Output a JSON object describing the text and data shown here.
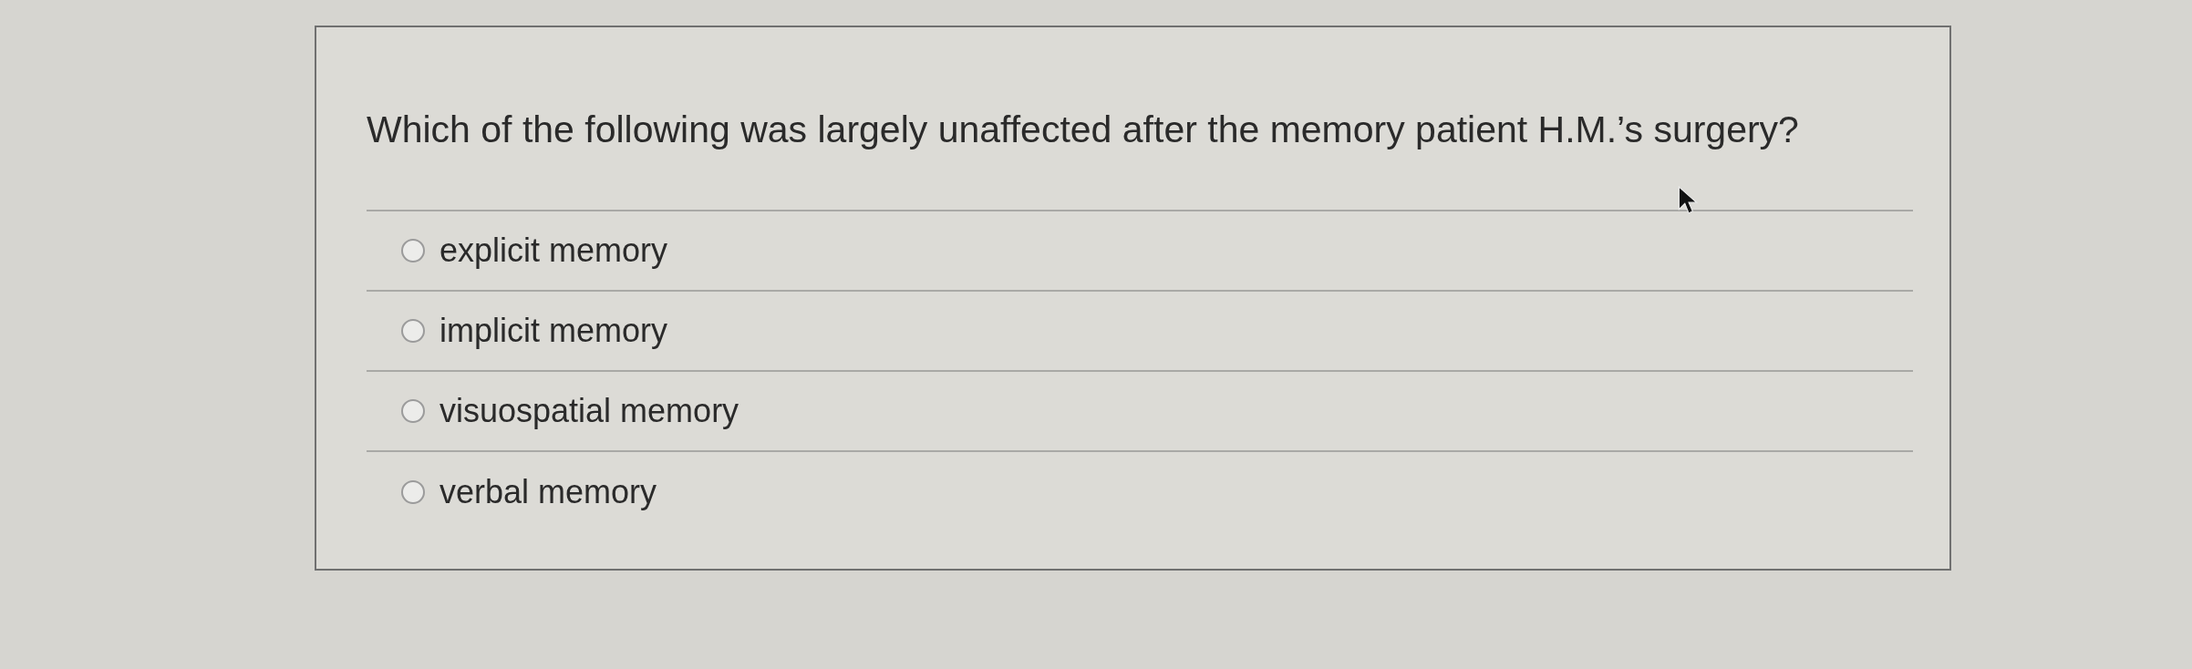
{
  "question": {
    "text": "Which of the following was largely unaffected after the memory patient H.M.’s surgery?"
  },
  "options": [
    {
      "label": "explicit memory",
      "selected": false
    },
    {
      "label": "implicit memory",
      "selected": false
    },
    {
      "label": "visuospatial memory",
      "selected": false
    },
    {
      "label": "verbal memory",
      "selected": false
    }
  ]
}
